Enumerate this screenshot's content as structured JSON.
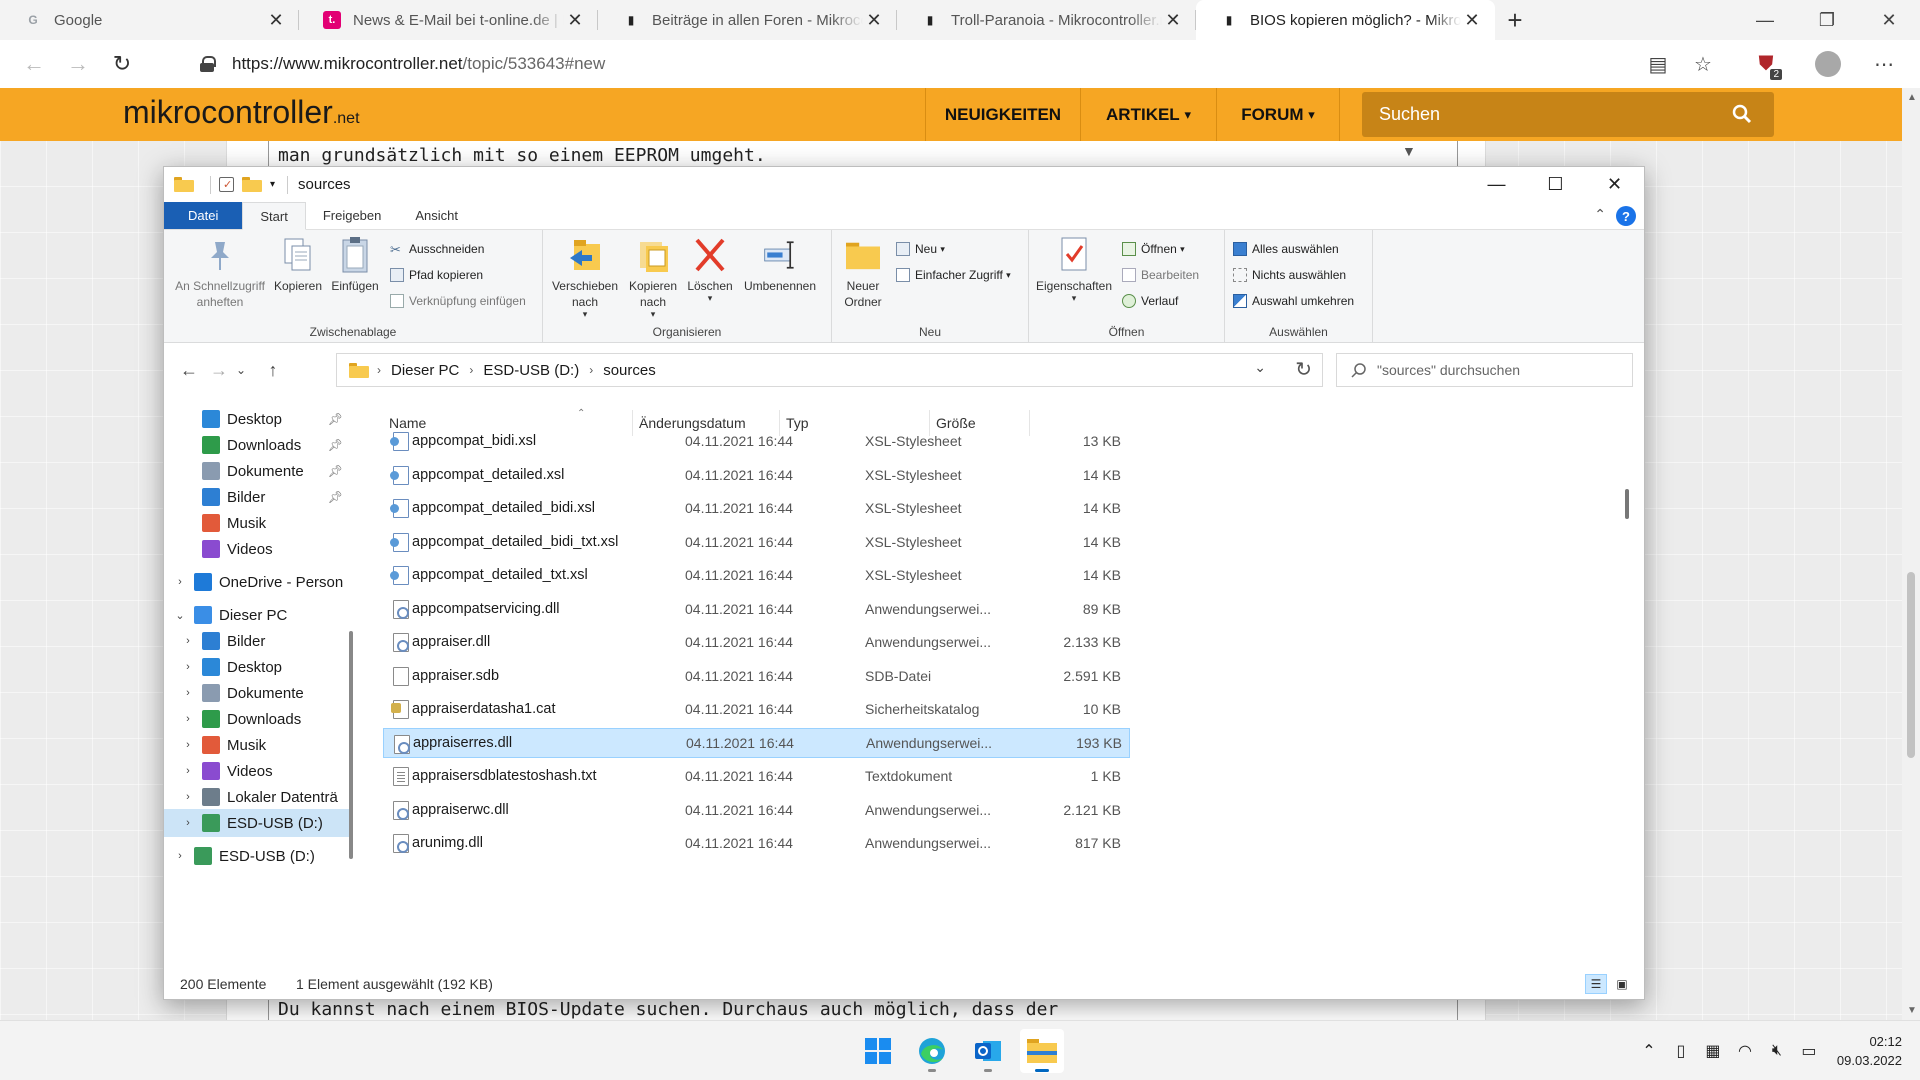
{
  "browser": {
    "tabs": [
      {
        "title": "Google",
        "favicon": "G",
        "favicon_color": "#9aa0a6"
      },
      {
        "title": "News & E-Mail bei t-online.de | N",
        "favicon": "t.",
        "favicon_color": "#e20074"
      },
      {
        "title": "Beiträge in allen Foren - Mikroco",
        "favicon": "▮",
        "favicon_color": "#222222"
      },
      {
        "title": "Troll-Paranoia - Mikrocontroller.n",
        "favicon": "▮",
        "favicon_color": "#222222"
      },
      {
        "title": "BIOS kopieren möglich? - Mikroc",
        "favicon": "▮",
        "favicon_color": "#222222"
      }
    ],
    "url_host": "https://www.mikrocontroller.net",
    "url_path": "/topic/533643#new",
    "extension_badge": "2"
  },
  "site": {
    "logo_main": "mikro",
    "logo_second": "controller",
    "logo_suffix": ".net",
    "nav": [
      "NEUIGKEITEN",
      "ARTIKEL",
      "FORUM"
    ],
    "search_placeholder": "Suchen",
    "accent": "#f6a623",
    "post_line_top": "man grundsätzlich mit so einem EEPROM umgeht.",
    "post_line_bottom": "Du kannst nach einem BIOS-Update suchen. Durchaus auch möglich, dass der"
  },
  "explorer": {
    "title": "sources",
    "ribbon_tabs": [
      "Datei",
      "Start",
      "Freigeben",
      "Ansicht"
    ],
    "groups": {
      "clipboard": {
        "label": "Zwischenablage",
        "pin": "An Schnellzugriff anheften",
        "copy": "Kopieren",
        "paste": "Einfügen",
        "cut": "Ausschneiden",
        "copy_path": "Pfad kopieren",
        "paste_shortcut": "Verknüpfung einfügen"
      },
      "organize": {
        "label": "Organisieren",
        "move": "Verschieben nach",
        "copy_to": "Kopieren nach",
        "delete": "Löschen",
        "rename": "Umbenennen"
      },
      "new": {
        "label": "Neu",
        "new_folder": "Neuer Ordner",
        "new_item": "Neu",
        "easy_access": "Einfacher Zugriff"
      },
      "open": {
        "label": "Öffnen",
        "properties": "Eigenschaften",
        "open": "Öffnen",
        "edit": "Bearbeiten",
        "history": "Verlauf"
      },
      "select": {
        "label": "Auswählen",
        "select_all": "Alles auswählen",
        "select_none": "Nichts auswählen",
        "invert": "Auswahl umkehren"
      }
    },
    "breadcrumb": [
      "Dieser PC",
      "ESD-USB (D:)",
      "sources"
    ],
    "search_placeholder": "\"sources\" durchsuchen",
    "nav_items": [
      {
        "label": "Desktop",
        "icon": "desktop-icon",
        "color": "#2b88d8",
        "pinned": true,
        "indent": 1,
        "expander": ""
      },
      {
        "label": "Downloads",
        "icon": "downloads-icon",
        "color": "#2e9b4a",
        "pinned": true,
        "indent": 1,
        "expander": ""
      },
      {
        "label": "Dokumente",
        "icon": "documents-icon",
        "color": "#8a9bb0",
        "pinned": true,
        "indent": 1,
        "expander": ""
      },
      {
        "label": "Bilder",
        "icon": "pictures-icon",
        "color": "#2d7fd3",
        "pinned": true,
        "indent": 1,
        "expander": ""
      },
      {
        "label": "Musik",
        "icon": "music-icon",
        "color": "#e25a3a",
        "pinned": false,
        "indent": 1,
        "expander": ""
      },
      {
        "label": "Videos",
        "icon": "videos-icon",
        "color": "#8a4bd0",
        "pinned": false,
        "indent": 1,
        "expander": ""
      },
      {
        "label": "OneDrive - Person",
        "icon": "onedrive-icon",
        "color": "#1e7ad8",
        "pinned": false,
        "indent": 0,
        "expander": "›"
      },
      {
        "label": "Dieser PC",
        "icon": "this-pc-icon",
        "color": "#3a8ee6",
        "pinned": false,
        "indent": 0,
        "expander": "⌄"
      },
      {
        "label": "Bilder",
        "icon": "pictures-icon",
        "color": "#2d7fd3",
        "pinned": false,
        "indent": 1,
        "expander": "›"
      },
      {
        "label": "Desktop",
        "icon": "desktop-icon",
        "color": "#2b88d8",
        "pinned": false,
        "indent": 1,
        "expander": "›"
      },
      {
        "label": "Dokumente",
        "icon": "documents-icon",
        "color": "#8a9bb0",
        "pinned": false,
        "indent": 1,
        "expander": "›"
      },
      {
        "label": "Downloads",
        "icon": "downloads-icon",
        "color": "#2e9b4a",
        "pinned": false,
        "indent": 1,
        "expander": "›"
      },
      {
        "label": "Musik",
        "icon": "music-icon",
        "color": "#e25a3a",
        "pinned": false,
        "indent": 1,
        "expander": "›"
      },
      {
        "label": "Videos",
        "icon": "videos-icon",
        "color": "#8a4bd0",
        "pinned": false,
        "indent": 1,
        "expander": "›"
      },
      {
        "label": "Lokaler Datenträ",
        "icon": "drive-icon",
        "color": "#6d7d8b",
        "pinned": false,
        "indent": 1,
        "expander": "›"
      },
      {
        "label": "ESD-USB (D:)",
        "icon": "usb-drive-icon",
        "color": "#3a9a5a",
        "pinned": false,
        "indent": 1,
        "expander": "›",
        "selected": true
      },
      {
        "label": "ESD-USB (D:)",
        "icon": "usb-drive-icon",
        "color": "#3a9a5a",
        "pinned": false,
        "indent": 0,
        "expander": "›"
      }
    ],
    "columns": [
      "Name",
      "Änderungsdatum",
      "Typ",
      "Größe"
    ],
    "files": [
      {
        "name": "appcompat_bidi.xsl",
        "date": "04.11.2021 16:44",
        "type": "XSL-Stylesheet",
        "size": "13 KB",
        "icon": "xsl"
      },
      {
        "name": "appcompat_detailed.xsl",
        "date": "04.11.2021 16:44",
        "type": "XSL-Stylesheet",
        "size": "14 KB",
        "icon": "xsl"
      },
      {
        "name": "appcompat_detailed_bidi.xsl",
        "date": "04.11.2021 16:44",
        "type": "XSL-Stylesheet",
        "size": "14 KB",
        "icon": "xsl"
      },
      {
        "name": "appcompat_detailed_bidi_txt.xsl",
        "date": "04.11.2021 16:44",
        "type": "XSL-Stylesheet",
        "size": "14 KB",
        "icon": "xsl"
      },
      {
        "name": "appcompat_detailed_txt.xsl",
        "date": "04.11.2021 16:44",
        "type": "XSL-Stylesheet",
        "size": "14 KB",
        "icon": "xsl"
      },
      {
        "name": "appcompatservicing.dll",
        "date": "04.11.2021 16:44",
        "type": "Anwendungserwei...",
        "size": "89 KB",
        "icon": "gear"
      },
      {
        "name": "appraiser.dll",
        "date": "04.11.2021 16:44",
        "type": "Anwendungserwei...",
        "size": "2.133 KB",
        "icon": "gear"
      },
      {
        "name": "appraiser.sdb",
        "date": "04.11.2021 16:44",
        "type": "SDB-Datei",
        "size": "2.591 KB",
        "icon": "blank"
      },
      {
        "name": "appraiserdatasha1.cat",
        "date": "04.11.2021 16:44",
        "type": "Sicherheitskatalog",
        "size": "10 KB",
        "icon": "cat"
      },
      {
        "name": "appraiserres.dll",
        "date": "04.11.2021 16:44",
        "type": "Anwendungserwei...",
        "size": "193 KB",
        "icon": "gear",
        "selected": true
      },
      {
        "name": "appraisersdblatestoshash.txt",
        "date": "04.11.2021 16:44",
        "type": "Textdokument",
        "size": "1 KB",
        "icon": "txt"
      },
      {
        "name": "appraiserwc.dll",
        "date": "04.11.2021 16:44",
        "type": "Anwendungserwei...",
        "size": "2.121 KB",
        "icon": "gear"
      },
      {
        "name": "arunimg.dll",
        "date": "04.11.2021 16:44",
        "type": "Anwendungserwei...",
        "size": "817 KB",
        "icon": "gear"
      }
    ],
    "status_count": "200 Elemente",
    "status_selection": "1 Element ausgewählt (192 KB)"
  },
  "taskbar": {
    "time": "02:12",
    "date": "09.03.2022"
  }
}
